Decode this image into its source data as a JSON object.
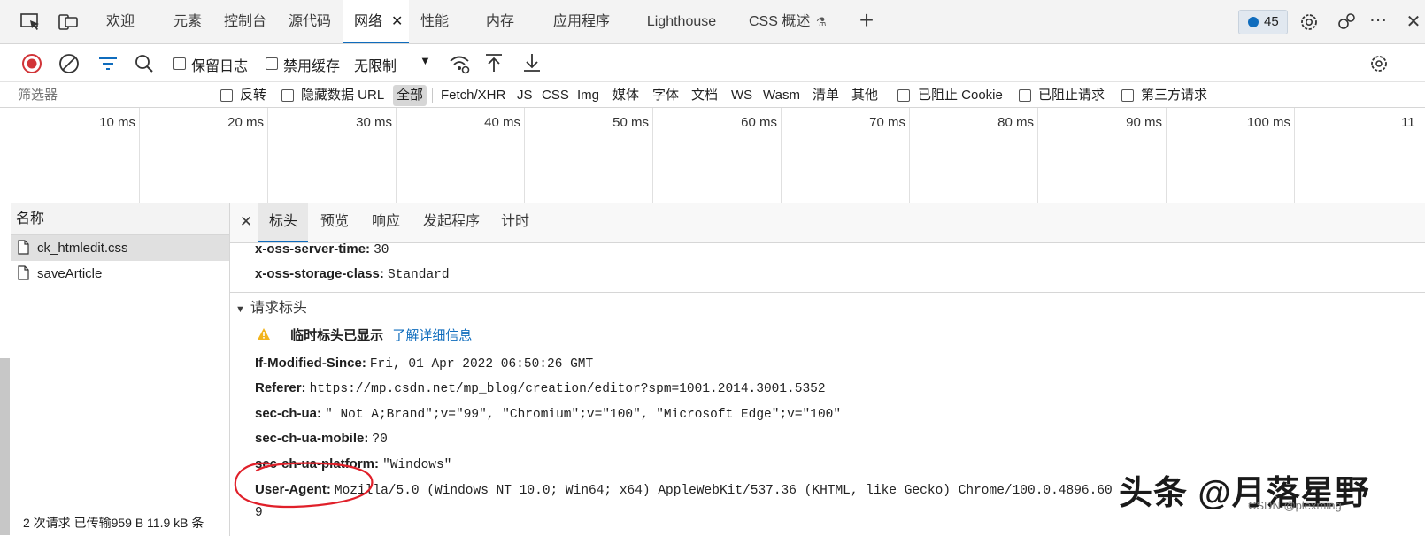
{
  "tabbar": {
    "tabs": [
      {
        "label": "欢迎"
      },
      {
        "label": "元素"
      },
      {
        "label": "控制台"
      },
      {
        "label": "源代码"
      },
      {
        "label": "网络"
      },
      {
        "label": "性能"
      },
      {
        "label": "内存"
      },
      {
        "label": "应用程序"
      },
      {
        "label": "Lighthouse"
      },
      {
        "label": "CSS 概述"
      }
    ],
    "active_tab": "网络",
    "issues_count": "45"
  },
  "toolbar": {
    "preserve_log": "保留日志",
    "disable_cache": "禁用缓存",
    "throttling": "无限制"
  },
  "filter": {
    "placeholder": "筛选器",
    "invert": "反转",
    "hide_data_url": "隐藏数据 URL",
    "types": [
      "全部",
      "Fetch/XHR",
      "JS",
      "CSS",
      "Img",
      "媒体",
      "字体",
      "文档",
      "WS",
      "Wasm",
      "清单",
      "其他"
    ],
    "blocked_cookies": "已阻止 Cookie",
    "blocked_requests": "已阻止请求",
    "third_party": "第三方请求"
  },
  "timeline": {
    "ticks": [
      "10 ms",
      "20 ms",
      "30 ms",
      "40 ms",
      "50 ms",
      "60 ms",
      "70 ms",
      "80 ms",
      "90 ms",
      "100 ms",
      "11"
    ]
  },
  "requests": {
    "header": "名称",
    "items": [
      {
        "name": "ck_htmledit.css"
      },
      {
        "name": "saveArticle"
      }
    ],
    "status": "2 次请求  已传输959 B  11.9 kB 条"
  },
  "details": {
    "tabs": [
      "标头",
      "预览",
      "响应",
      "发起程序",
      "计时"
    ],
    "active_tab": "标头",
    "response_headers_tail": [
      {
        "name": "x-oss-server-time:",
        "value": "30"
      },
      {
        "name": "x-oss-storage-class:",
        "value": "Standard"
      }
    ],
    "request_section_title": "请求标头",
    "provisional_warning": "临时标头已显示",
    "learn_more": "了解详细信息",
    "request_headers": [
      {
        "name": "If-Modified-Since:",
        "value": "Fri, 01 Apr 2022 06:50:26 GMT"
      },
      {
        "name": "Referer:",
        "value": "https://mp.csdn.net/mp_blog/creation/editor?spm=1001.2014.3001.5352"
      },
      {
        "name": "sec-ch-ua:",
        "value": "\" Not A;Brand\";v=\"99\", \"Chromium\";v=\"100\", \"Microsoft Edge\";v=\"100\""
      },
      {
        "name": "sec-ch-ua-mobile:",
        "value": "?0"
      },
      {
        "name": "sec-ch-ua-platform:",
        "value": "\"Windows\""
      },
      {
        "name": "User-Agent:",
        "value": "Mozilla/5.0 (Windows NT 10.0; Win64; x64) AppleWebKit/537.36 (KHTML, like Gecko) Chrome/100.0.4896.60"
      }
    ],
    "wrap_tail": "9"
  },
  "watermark": {
    "main": "头条 @月落星野",
    "sub": "CSDN @plexming"
  },
  "colors": {
    "accent": "#0f6cbd",
    "record": "#d13438",
    "warning": "#f2b41c",
    "annotation": "#e0202a"
  }
}
